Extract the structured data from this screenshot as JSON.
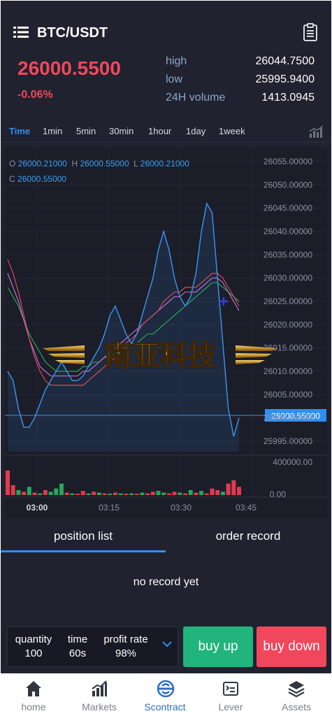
{
  "header": {
    "pair": "BTC/USDT",
    "menu_icon": "list-icon",
    "record_icon": "clipboard-icon"
  },
  "ticker": {
    "price": "26000.5500",
    "change": "-0.06%",
    "price_color": "#f0475c",
    "stats": [
      {
        "label": "high",
        "value": "26044.7500"
      },
      {
        "label": "low",
        "value": "25995.9400"
      },
      {
        "label": "24H volume",
        "value": "1413.0945"
      }
    ]
  },
  "timeframes": {
    "active": "Time",
    "items": [
      "Time",
      "1min",
      "5min",
      "30min",
      "1hour",
      "1day",
      "1week"
    ],
    "indicator_icon": "bar-chart-icon"
  },
  "ohlc": {
    "O": "26000.21000",
    "H": "26000.55000",
    "L": "26000.21000",
    "C": "26000.55000"
  },
  "watermark": "南亚科技",
  "chart_data": {
    "type": "line",
    "y_ticks": [
      "26055.00000",
      "26050.00000",
      "26045.00000",
      "26040.00000",
      "26035.00000",
      "26030.00000",
      "26025.00000",
      "26020.00000",
      "26015.00000",
      "26010.00000",
      "26005.00000",
      "26000.00000",
      "25995.00000"
    ],
    "ylim": [
      25992,
      26057
    ],
    "x_ticks": [
      "03:00",
      "03:15",
      "03:30",
      "03:45"
    ],
    "current_price_label": "26000.55000",
    "current_price": 26000.55,
    "price": [
      26010,
      26008,
      26002,
      25998,
      25998,
      26000,
      26003,
      26006,
      26008,
      26010,
      26012,
      26010,
      26008,
      26008,
      26009,
      26011,
      26013,
      26015,
      26018,
      26022,
      26024,
      26021,
      26018,
      26016,
      26018,
      26022,
      26026,
      26030,
      26036,
      26040,
      26036,
      26030,
      26026,
      26024,
      26026,
      26031,
      26040,
      26046,
      26044,
      26030,
      26016,
      26002,
      25996,
      26000
    ],
    "ma_red": [
      26034,
      26031,
      26027,
      26022,
      26017,
      26013,
      26010,
      26008,
      26007,
      26007,
      26007,
      26007,
      26007,
      26007,
      26007,
      26008,
      26009,
      26010,
      26011,
      26012,
      26013,
      26014,
      26016,
      26017,
      26018,
      26020,
      26021,
      26022,
      26023,
      26025,
      26026,
      26027,
      26027,
      26028,
      26028,
      26028,
      26029,
      26030,
      26031,
      26031,
      26030,
      26028,
      26026,
      26024
    ],
    "ma_green": [
      26028,
      26026,
      26024,
      26021,
      26018,
      26016,
      26014,
      26012,
      26011,
      26010,
      26010,
      26010,
      26010,
      26010,
      26011,
      26011,
      26012,
      26012,
      26013,
      26013,
      26014,
      26014,
      26015,
      26016,
      26016,
      26017,
      26018,
      26018,
      26019,
      26020,
      26021,
      26022,
      26023,
      26024,
      26025,
      26026,
      26027,
      26028,
      26029,
      26029,
      26028,
      26027,
      26026,
      26025
    ],
    "ma_pink": [
      26031,
      26028,
      26025,
      26021,
      26017,
      26014,
      26011,
      26010,
      26009,
      26009,
      26009,
      26009,
      26009,
      26009,
      26010,
      26010,
      26011,
      26012,
      26013,
      26014,
      26015,
      26016,
      26017,
      26018,
      26019,
      26020,
      26021,
      26022,
      26023,
      26024,
      26025,
      26026,
      26026,
      26027,
      26027,
      26027,
      26028,
      26029,
      26030,
      26030,
      26029,
      26027,
      26025,
      26023
    ],
    "volume_tick_top": "400000.00",
    "volume_tick_bottom": "0.00",
    "volume_ylim": [
      0,
      400000
    ],
    "volume": [
      {
        "v": 300000,
        "d": "down"
      },
      {
        "v": 120000,
        "d": "down"
      },
      {
        "v": 60000,
        "d": "up"
      },
      {
        "v": 40000,
        "d": "down"
      },
      {
        "v": 100000,
        "d": "up"
      },
      {
        "v": 30000,
        "d": "down"
      },
      {
        "v": 20000,
        "d": "up"
      },
      {
        "v": 60000,
        "d": "down"
      },
      {
        "v": 40000,
        "d": "up"
      },
      {
        "v": 80000,
        "d": "up"
      },
      {
        "v": 140000,
        "d": "up"
      },
      {
        "v": 30000,
        "d": "down"
      },
      {
        "v": 20000,
        "d": "up"
      },
      {
        "v": 10000,
        "d": "down"
      },
      {
        "v": 50000,
        "d": "down"
      },
      {
        "v": 20000,
        "d": "up"
      },
      {
        "v": 40000,
        "d": "down"
      },
      {
        "v": 30000,
        "d": "up"
      },
      {
        "v": 20000,
        "d": "down"
      },
      {
        "v": 10000,
        "d": "up"
      },
      {
        "v": 30000,
        "d": "down"
      },
      {
        "v": 20000,
        "d": "up"
      },
      {
        "v": 10000,
        "d": "down"
      },
      {
        "v": 20000,
        "d": "up"
      },
      {
        "v": 10000,
        "d": "down"
      },
      {
        "v": 30000,
        "d": "up"
      },
      {
        "v": 20000,
        "d": "down"
      },
      {
        "v": 40000,
        "d": "down"
      },
      {
        "v": 50000,
        "d": "up"
      },
      {
        "v": 30000,
        "d": "up"
      },
      {
        "v": 20000,
        "d": "down"
      },
      {
        "v": 40000,
        "d": "down"
      },
      {
        "v": 30000,
        "d": "up"
      },
      {
        "v": 20000,
        "d": "down"
      },
      {
        "v": 60000,
        "d": "up"
      },
      {
        "v": 30000,
        "d": "down"
      },
      {
        "v": 50000,
        "d": "up"
      },
      {
        "v": 20000,
        "d": "down"
      },
      {
        "v": 80000,
        "d": "down"
      },
      {
        "v": 60000,
        "d": "down"
      },
      {
        "v": 40000,
        "d": "up"
      },
      {
        "v": 140000,
        "d": "down"
      },
      {
        "v": 180000,
        "d": "down"
      },
      {
        "v": 100000,
        "d": "down"
      }
    ],
    "colors": {
      "price": "#3b8fe6",
      "ma_red": "#d84a5e",
      "ma_green": "#2aa55a",
      "ma_pink": "#c06fd0",
      "up": "#2aa55a",
      "down": "#e23a4e"
    }
  },
  "tabs": {
    "items": [
      "position list",
      "order record"
    ],
    "active": 0
  },
  "empty_text": "no record yet",
  "order": {
    "quantity_label": "quantity",
    "quantity_value": "100",
    "time_label": "time",
    "time_value": "60s",
    "profit_label": "profit rate",
    "profit_value": "98%",
    "buy_up": "buy up",
    "buy_down": "buy down",
    "up_color": "#21b47c",
    "down_color": "#f0475c"
  },
  "nav": {
    "active": "Scontract",
    "items": [
      {
        "label": "home",
        "icon": "home-icon"
      },
      {
        "label": "Markets",
        "icon": "markets-icon"
      },
      {
        "label": "Scontract",
        "icon": "scontract-icon"
      },
      {
        "label": "Lever",
        "icon": "lever-icon"
      },
      {
        "label": "Assets",
        "icon": "assets-icon"
      }
    ]
  }
}
